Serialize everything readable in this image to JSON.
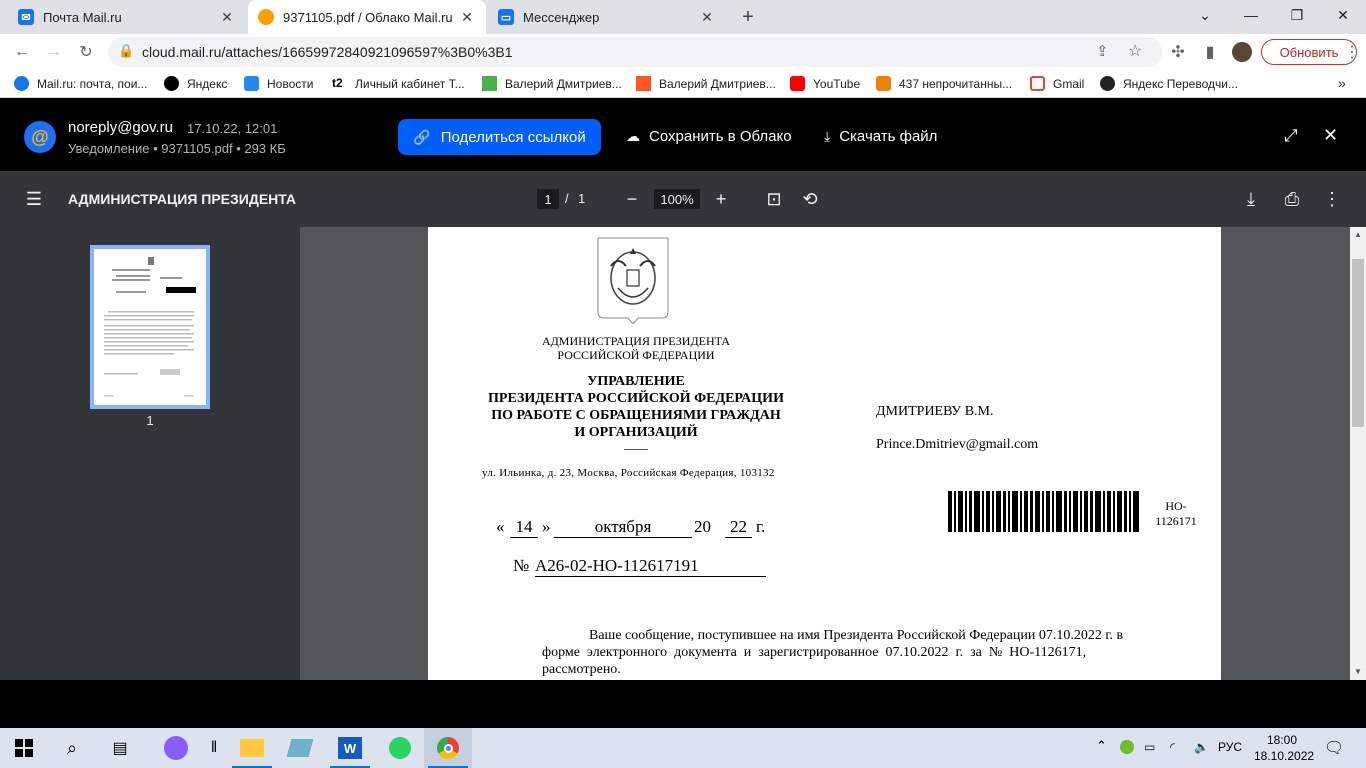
{
  "browser": {
    "tabs": [
      {
        "title": "Почта Mail.ru"
      },
      {
        "title": "9371105.pdf / Облако Mail.ru"
      },
      {
        "title": "Мессенджер"
      }
    ],
    "url": "cloud.mail.ru/attaches/16659972840921096597%3B0%3B1",
    "update_label": "Обновить",
    "bookmarks": [
      {
        "label": "Mail.ru: почта, пои..."
      },
      {
        "label": "Яндекс"
      },
      {
        "label": "Новости"
      },
      {
        "label": "Личный кабинет Т..."
      },
      {
        "label": "Валерий Дмитриев..."
      },
      {
        "label": "Валерий Дмитриев..."
      },
      {
        "label": "YouTube"
      },
      {
        "label": "437 непрочитанны..."
      },
      {
        "label": "Gmail"
      },
      {
        "label": "Яндекс Переводчи..."
      }
    ],
    "bookmarks_more": "»"
  },
  "cloud": {
    "sender": "noreply@gov.ru",
    "time": "17.10.22, 12:01",
    "subtitle": "Уведомление • 9371105.pdf • 293 КБ",
    "share_label": "Поделиться ссылкой",
    "save_label": "Сохранить в Облако",
    "download_label": "Скачать файл"
  },
  "pdf": {
    "title": "АДМИНИСТРАЦИЯ ПРЕЗИДЕНТА",
    "page_current": "1",
    "page_sep": "/",
    "page_total": "1",
    "zoom": "100%",
    "thumb_page": "1"
  },
  "doc": {
    "admin_line1": "АДМИНИСТРАЦИЯ ПРЕЗИДЕНТА",
    "admin_line2": "РОССИЙСКОЙ ФЕДЕРАЦИИ",
    "dept_line1": "УПРАВЛЕНИЕ",
    "dept_line2": "ПРЕЗИДЕНТА РОССИЙСКОЙ ФЕДЕРАЦИИ",
    "dept_line3": "ПО РАБОТЕ С ОБРАЩЕНИЯМИ ГРАЖДАН",
    "dept_line4": "И ОРГАНИЗАЦИЙ",
    "address": "ул. Ильинка, д. 23, Москва, Российская Федерация, 103132",
    "recipient": "ДМИТРИЕВУ В.М.",
    "email": "Prince.Dmitriev@gmail.com",
    "barcode_code_line1": "НО-",
    "barcode_code_line2": "1126171",
    "date_open": "«",
    "date_day": "14",
    "date_close": "»",
    "date_month": "октября",
    "date_year_prefix": "20",
    "date_year": "22",
    "date_suffix": "г.",
    "number_prefix": "№",
    "number": "А26-02-НО-112617191",
    "body_line1": "Ваше сообщение, поступившее на имя Президента Российской Федерации 07.10.2022 г. в",
    "body_line2": "форме  электронного  документа  и  зарегистрированное  07.10.2022  г.  за  №  НО-1126171,",
    "body_line3": "рассмотрено."
  },
  "taskbar": {
    "lang": "РУС",
    "time": "18:00",
    "date": "18.10.2022"
  },
  "colors": {
    "accent": "#005ff9",
    "update": "#d93025"
  }
}
